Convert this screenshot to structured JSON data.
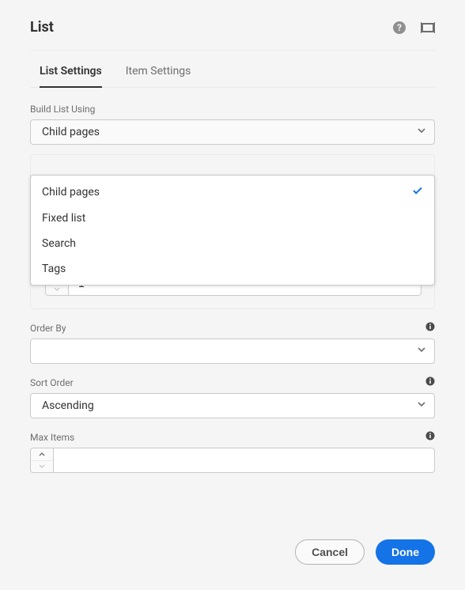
{
  "header": {
    "title": "List"
  },
  "tabs": {
    "list_settings": "List Settings",
    "item_settings": "Item Settings"
  },
  "fields": {
    "build_list_label": "Build List Using",
    "build_list_value": "Child pages",
    "order_by_label": "Order By",
    "order_by_value": "",
    "sort_order_label": "Sort Order",
    "sort_order_value": "Ascending",
    "max_items_label": "Max Items",
    "max_items_value": "",
    "hidden_stepper_value": "1"
  },
  "dropdown": {
    "options": [
      {
        "label": "Child pages",
        "selected": true
      },
      {
        "label": "Fixed list",
        "selected": false
      },
      {
        "label": "Search",
        "selected": false
      },
      {
        "label": "Tags",
        "selected": false
      }
    ]
  },
  "footer": {
    "cancel": "Cancel",
    "done": "Done"
  }
}
